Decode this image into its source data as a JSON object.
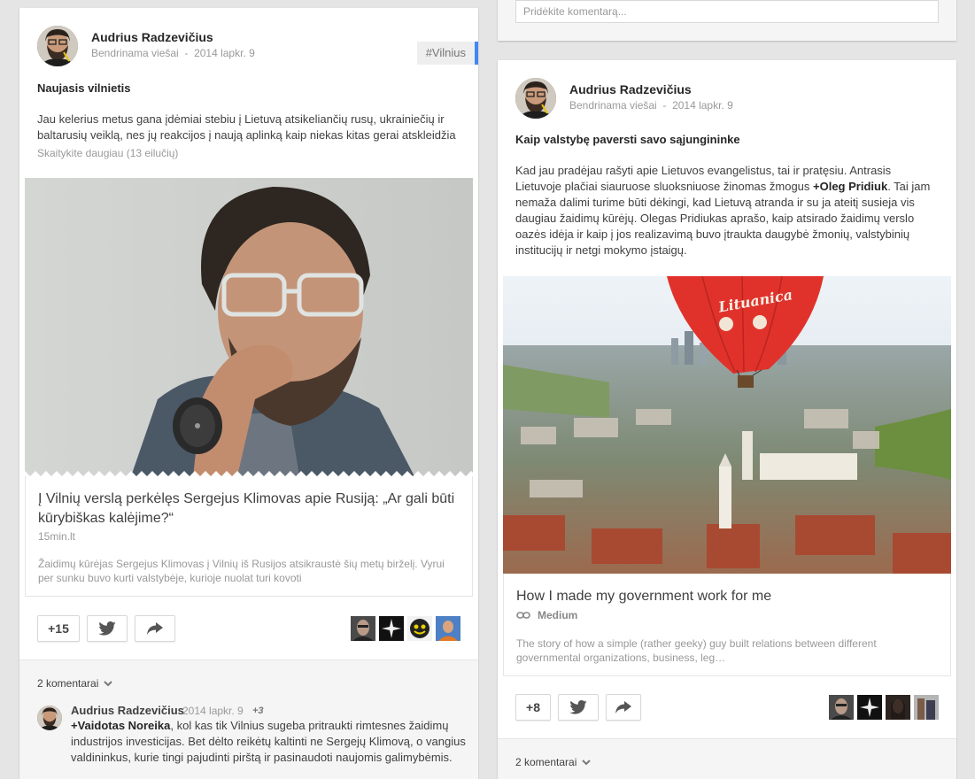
{
  "right_top": {
    "comment_placeholder": "Pridėkite komentarą..."
  },
  "post1": {
    "author": "Audrius Radzevičius",
    "visibility": "Bendrinama viešai",
    "separator": "-",
    "date": "2014 lapkr. 9",
    "tag": "#Vilnius",
    "title": "Naujasis vilnietis",
    "body_line1": "Jau kelerius metus gana įdėmiai stebiu į Lietuvą atsikeliančių rusų, ukrainiečių ir",
    "body_line2": "baltarusių veiklą, nes jų reakcijos į naują aplinką kaip niekas kitas gerai atskleidžia",
    "read_more": "Skaitykite daugiau (13 eilučių)",
    "link_title": "Į Vilnių verslą perkėlęs Sergejus Klimovas apie Rusiją: „Ar gali būti kūrybiškas kalėjime?“",
    "link_source": "15min.lt",
    "link_desc": "Žaidimų kūrėjas Sergejus Klimovas į Vilnių iš Rusijos atsikraustė šių metų birželį. Vyrui per sunku buvo kurti valstybėje, kurioje nuolat turi kovoti",
    "plusone": "+15",
    "comments_count": "2 komentarai",
    "comment": {
      "author": "Audrius Radzevičius",
      "date": "2014 lapkr. 9",
      "plus": "+3",
      "mention": "+Vaidotas Noreika",
      "text": ", kol kas tik Vilnius sugeba pritraukti rimtesnes žaidimų industrijos investicijas. Bet dėlto reikėtų kaltinti ne Sergejų Klimovą, o vangius valdininkus, kurie tingi pajudinti pirštą ir pasinaudoti naujomis galimybėmis."
    }
  },
  "post2": {
    "author": "Audrius Radzevičius",
    "visibility": "Bendrinama viešai",
    "separator": "-",
    "date": "2014 lapkr. 9",
    "title": "Kaip valstybę paversti savo sąjungininke",
    "body_part1": "Kad jau pradėjau rašyti apie Lietuvos evangelistus, tai ir pratęsiu. Antrasis Lietuvoje plačiai siauruose sluoksniuose žinomas žmogus ",
    "mention": "+Oleg Pridiuk",
    "body_part2": ". Tai jam nemaža dalimi turime būti dėkingi, kad Lietuvą atranda ir su ja ateitį susieja vis daugiau žaidimų kūrėjų. Olegas Pridiukas aprašo, kaip atsirado žaidimų verslo oazės idėja ir kaip į jos realizavimą buvo įtraukta daugybė žmonių, valstybinių institucijų ir netgi mokymo įstaigų.",
    "balloon_text": "Lituanica",
    "link_title": "How I made my government work for me",
    "link_source": "Medium",
    "link_desc": "The story of how a simple (rather geeky) guy built relations between different governmental organizations, business, leg…",
    "plusone": "+8",
    "comments_count": "2 komentarai"
  },
  "colors": {
    "accent_blue": "#4285f4",
    "balloon_red": "#e0322b"
  }
}
